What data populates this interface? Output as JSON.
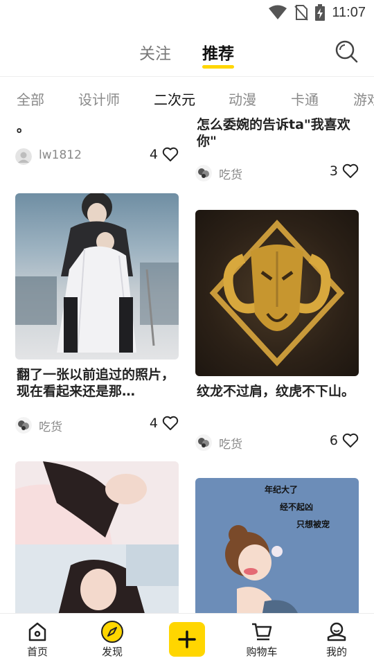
{
  "status_bar": {
    "time": "11:07",
    "icons": [
      "wifi-icon",
      "no-sim-icon",
      "battery-charging-icon"
    ]
  },
  "header": {
    "tabs": [
      {
        "label": "关注",
        "active": false
      },
      {
        "label": "推荐",
        "active": true
      }
    ],
    "accent_color": "#ffd600",
    "search_icon": "search-icon"
  },
  "categories": [
    {
      "label": "全部",
      "active": false
    },
    {
      "label": "设计师",
      "active": false
    },
    {
      "label": "二次元",
      "active": true
    },
    {
      "label": "动漫",
      "active": false
    },
    {
      "label": "卡通",
      "active": false
    },
    {
      "label": "游戏",
      "active": false
    }
  ],
  "feed": {
    "left": [
      {
        "title": "。",
        "username": "lw1812",
        "likes": "4"
      },
      {
        "title": "翻了一张以前追过的照片，现在看起来还是那…",
        "username": "吃货",
        "likes": "4"
      },
      {
        "title": "",
        "username": "",
        "likes": ""
      }
    ],
    "right": [
      {
        "title": "怎么委婉的告诉ta\"我喜欢你\"",
        "username": "吃货",
        "likes": "3"
      },
      {
        "title": "纹龙不过肩，纹虎不下山。",
        "username": "吃货",
        "likes": "6"
      },
      {
        "title": "",
        "image_text": [
          "年纪大了",
          "经不起凶",
          "只想被宠"
        ],
        "username": "",
        "likes": ""
      }
    ]
  },
  "bottom_nav": {
    "items": [
      {
        "label": "首页",
        "icon": "home-icon"
      },
      {
        "label": "发现",
        "icon": "compass-icon"
      },
      {
        "label": "",
        "icon": "plus-icon"
      },
      {
        "label": "购物车",
        "icon": "cart-icon"
      },
      {
        "label": "我的",
        "icon": "profile-icon"
      }
    ]
  }
}
